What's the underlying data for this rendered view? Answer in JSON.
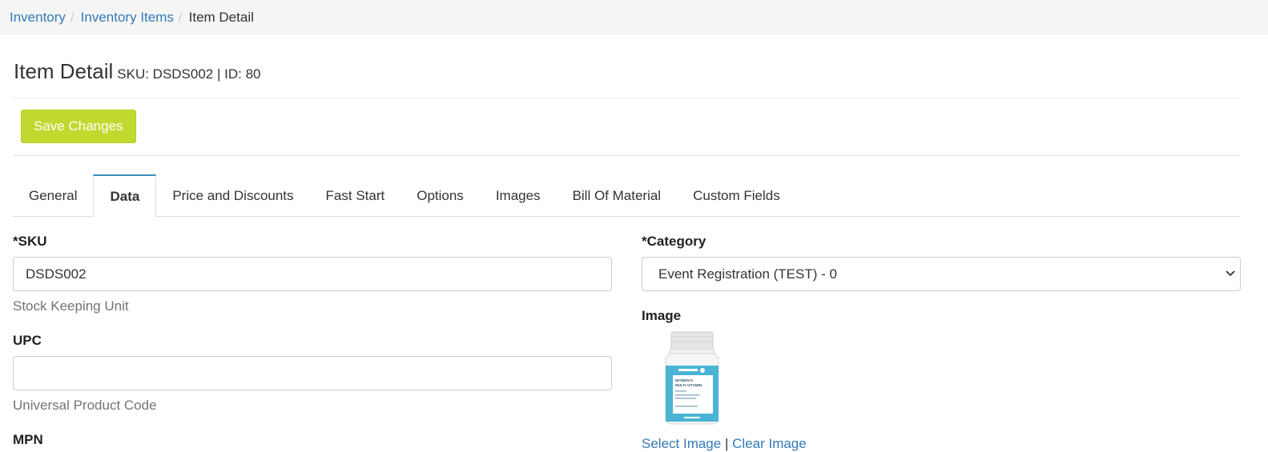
{
  "breadcrumb": {
    "items": [
      "Inventory",
      "Inventory Items"
    ],
    "current": "Item Detail",
    "separator": "/"
  },
  "header": {
    "title": "Item Detail",
    "subtitle": "SKU: DSDS002 | ID: 80"
  },
  "toolbar": {
    "save_label": "Save Changes",
    "save_color": "#c1d82f"
  },
  "tabs": [
    {
      "label": "General",
      "active": false
    },
    {
      "label": "Data",
      "active": true
    },
    {
      "label": "Price and Discounts",
      "active": false
    },
    {
      "label": "Fast Start",
      "active": false
    },
    {
      "label": "Options",
      "active": false
    },
    {
      "label": "Images",
      "active": false
    },
    {
      "label": "Bill Of Material",
      "active": false
    },
    {
      "label": "Custom Fields",
      "active": false
    }
  ],
  "form": {
    "sku": {
      "label": "*SKU",
      "value": "DSDS002",
      "help": "Stock Keeping Unit"
    },
    "upc": {
      "label": "UPC",
      "value": "",
      "help": "Universal Product Code"
    },
    "mpn": {
      "label": "MPN"
    },
    "category": {
      "label": "*Category",
      "selected": "Event Registration (TEST) - 0"
    },
    "image": {
      "label": "Image",
      "select_label": "Select Image",
      "separator": "|",
      "clear_label": "Clear Image",
      "bottle_label_lines": [
        "WOMEN'S",
        "MULTI-VITAMIN"
      ]
    }
  },
  "colors": {
    "link": "#337ab7",
    "tab_active_border": "#3c8dbc",
    "bottle_label": "#4ab3d6"
  }
}
